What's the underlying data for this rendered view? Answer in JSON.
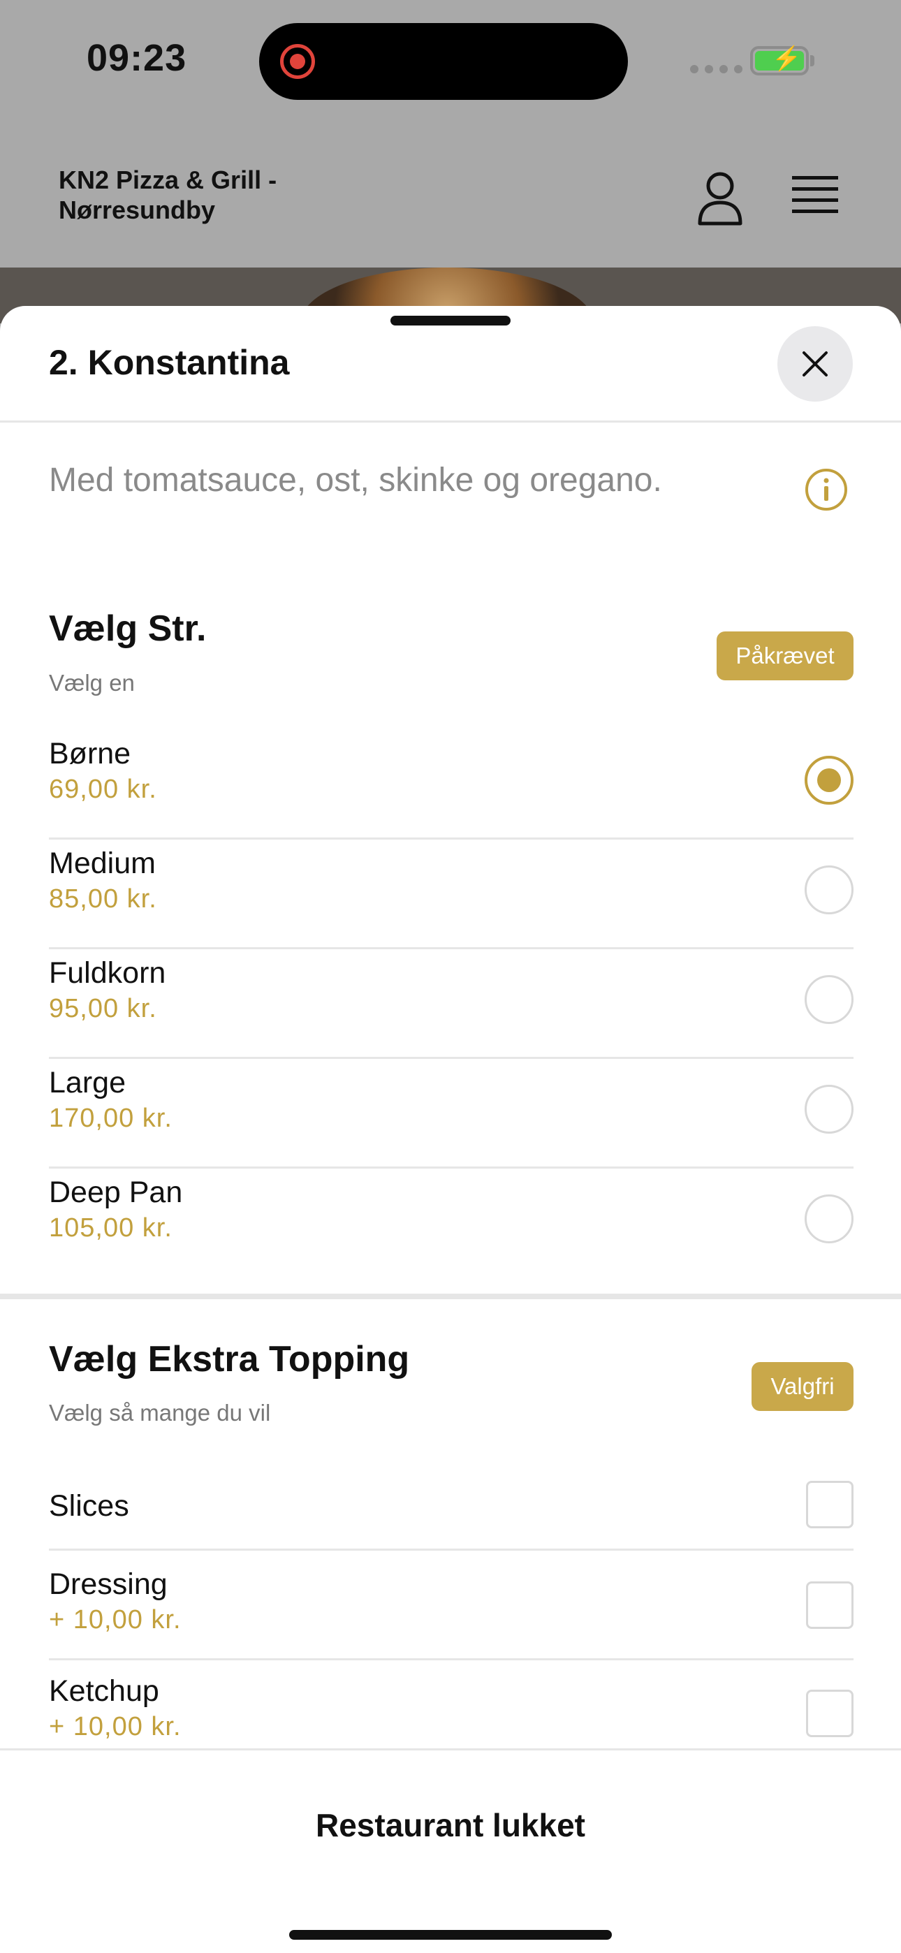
{
  "status_bar": {
    "time": "09:23"
  },
  "header": {
    "restaurant_name": "KN2 Pizza & Grill - Nørresundby",
    "icons": [
      "user-icon",
      "menu-icon"
    ]
  },
  "sheet": {
    "title": "2. Konstantina",
    "description": "Med tomatsauce, ost, skinke og oregano."
  },
  "size_group": {
    "title": "Vælg Str.",
    "subtitle": "Vælg en",
    "badge": "Påkrævet",
    "options": [
      {
        "name": "Børne",
        "price": "69,00 kr.",
        "selected": true
      },
      {
        "name": "Medium",
        "price": "85,00 kr.",
        "selected": false
      },
      {
        "name": "Fuldkorn",
        "price": "95,00 kr.",
        "selected": false
      },
      {
        "name": "Large",
        "price": "170,00 kr.",
        "selected": false
      },
      {
        "name": "Deep Pan",
        "price": "105,00 kr.",
        "selected": false
      }
    ]
  },
  "topping_group": {
    "title": "Vælg Ekstra Topping",
    "subtitle": "Vælg så mange du vil",
    "badge": "Valgfri",
    "options": [
      {
        "name": "Slices",
        "price": ""
      },
      {
        "name": "Dressing",
        "price": "+ 10,00 kr."
      },
      {
        "name": "Ketchup",
        "price": "+ 10,00 kr."
      }
    ]
  },
  "footer": {
    "label": "Restaurant lukket"
  },
  "colors": {
    "accent": "#c2a03d",
    "badge": "#c9a84a",
    "overlay": "#a9a9a9"
  }
}
